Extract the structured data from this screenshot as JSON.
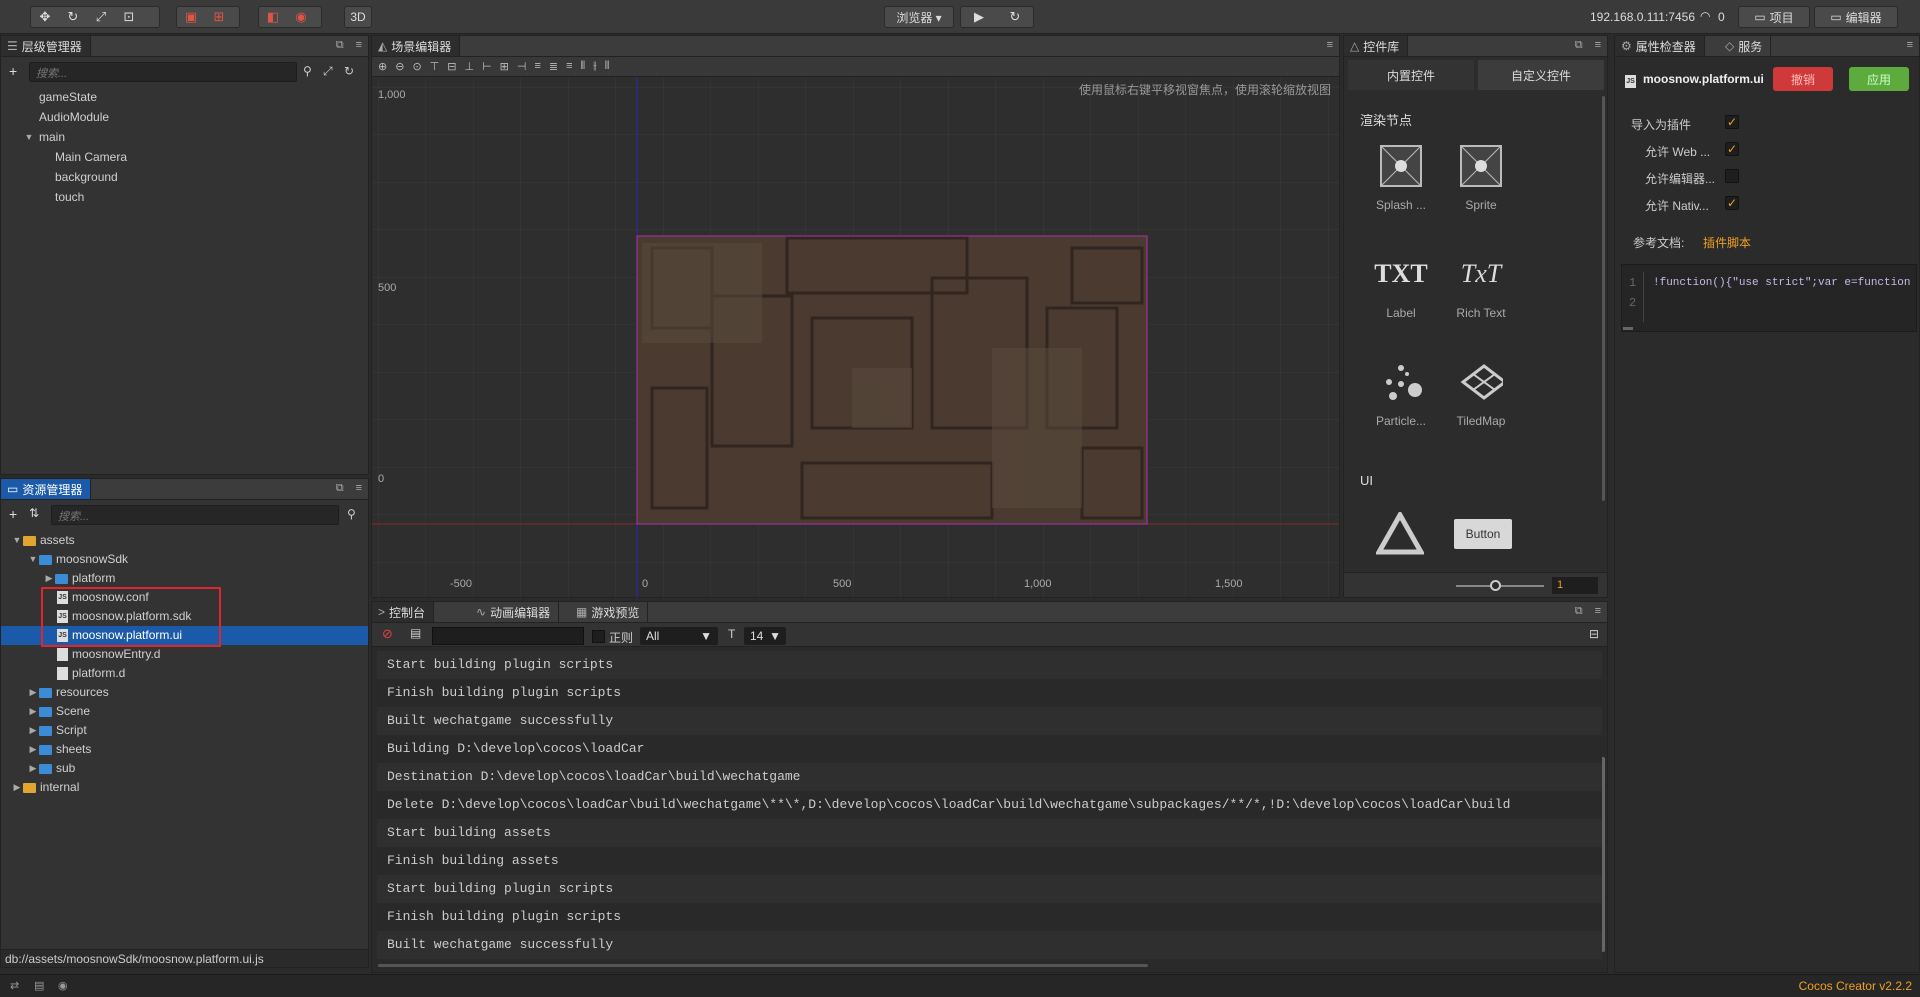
{
  "toolbar": {
    "preview_label": "浏览器 ▾",
    "three_d_label": "3D",
    "ip": "192.168.0.111:7456",
    "ip_count": "0",
    "project_btn": "项目",
    "editor_btn": "编辑器"
  },
  "hierarchy": {
    "title": "层级管理器",
    "search_placeholder": "搜索...",
    "nodes": [
      "gameState",
      "AudioModule",
      "main",
      "Main Camera",
      "background",
      "touch"
    ]
  },
  "assets": {
    "title": "资源管理器",
    "search_placeholder": "搜索...",
    "items": [
      "assets",
      "moosnowSdk",
      "platform",
      "moosnow.conf",
      "moosnow.platform.sdk",
      "moosnow.platform.ui",
      "moosnowEntry.d",
      "platform.d",
      "resources",
      "Scene",
      "Script",
      "sheets",
      "sub",
      "internal"
    ],
    "path": "db://assets/moosnowSdk/moosnow.platform.ui.js"
  },
  "scene": {
    "title": "场景编辑器",
    "hint": "使用鼠标右键平移视窗焦点，使用滚轮缩放视图",
    "y_labels": [
      "1,000",
      "500",
      "0"
    ],
    "x_labels": [
      "-500",
      "0",
      "500",
      "1,000",
      "1,500"
    ]
  },
  "widgets": {
    "title": "控件库",
    "tab_builtin": "内置控件",
    "tab_custom": "自定义控件",
    "section_render": "渲染节点",
    "section_ui": "UI",
    "items": [
      "Splash ...",
      "Sprite",
      "Label",
      "Rich Text",
      "Particle...",
      "TiledMap"
    ],
    "txt1": "TXT",
    "txt2": "TxT",
    "button_text": "Button",
    "zoom_value": "1"
  },
  "inspector": {
    "title": "属性检查器",
    "service_tab": "服务",
    "file_name": "moosnow.platform.ui",
    "revert_btn": "撤销",
    "apply_btn": "应用",
    "import_as_plugin": "导入为插件",
    "allow_web": "允许 Web ...",
    "allow_editor": "允许编辑器...",
    "allow_native": "允许 Nativ...",
    "ref_doc_label": "参考文档:",
    "ref_doc_link": "插件脚本",
    "code_line1_num": "1",
    "code_line2_num": "2",
    "code_line1": "!function(){\"use strict\";var e=function"
  },
  "console": {
    "tab_console": "控制台",
    "tab_anim": "动画编辑器",
    "tab_preview": "游戏预览",
    "regex_label": "正则",
    "filter_value": "All",
    "font_size": "14",
    "logs": [
      "Start building plugin scripts",
      "Finish building plugin scripts",
      "Built wechatgame successfully",
      "Building D:\\develop\\cocos\\loadCar",
      "Destination D:\\develop\\cocos\\loadCar\\build\\wechatgame",
      "Delete D:\\develop\\cocos\\loadCar\\build\\wechatgame\\**\\*,D:\\develop\\cocos\\loadCar\\build\\wechatgame\\subpackages/**/*,!D:\\develop\\cocos\\loadCar\\build",
      "Start building assets",
      "Finish building assets",
      "Start building plugin scripts",
      "Finish building plugin scripts",
      "Built wechatgame successfully"
    ]
  },
  "statusbar": {
    "version": "Cocos Creator v2.2.2"
  },
  "colors": {
    "accent": "#e0a631",
    "selection": "#1a5aa8",
    "highlight_box": "#e0262c",
    "apply": "#5dab3c",
    "revert": "#d0393a"
  }
}
